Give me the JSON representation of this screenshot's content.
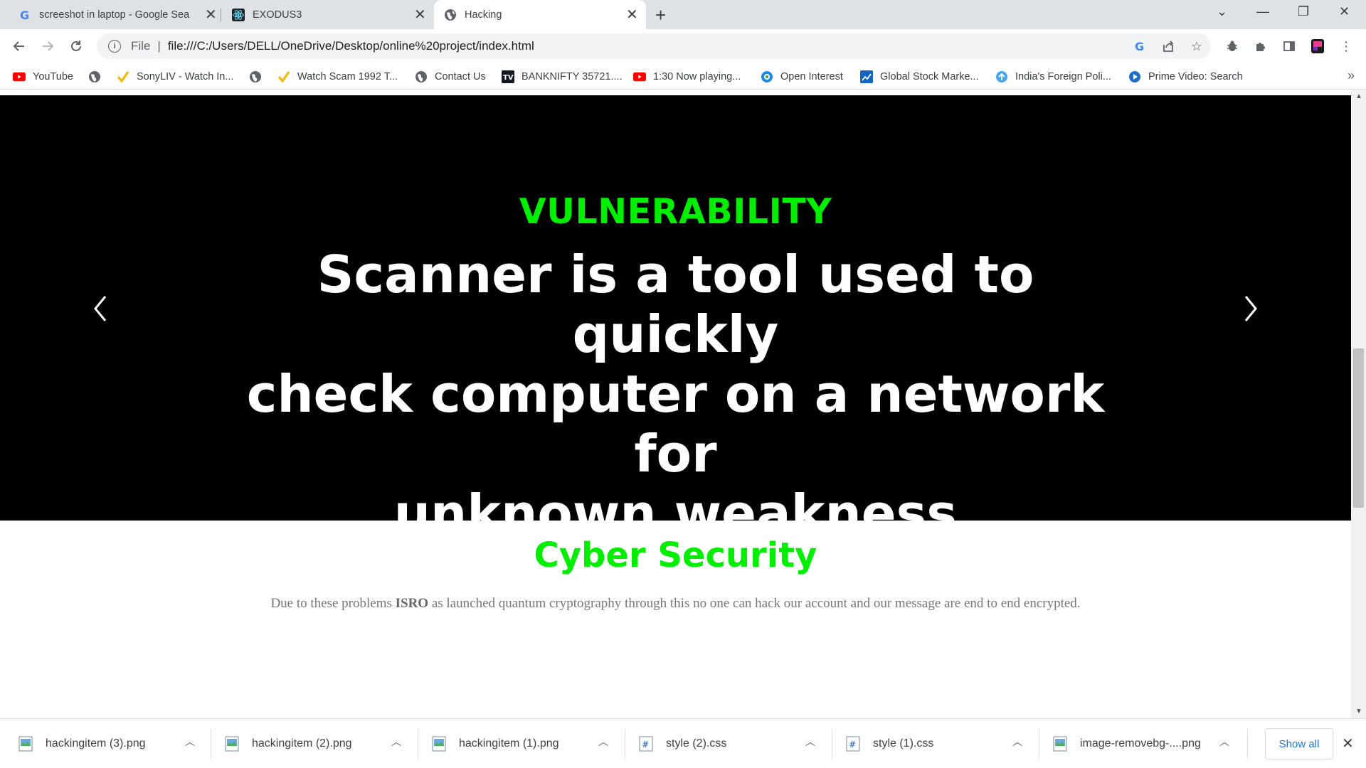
{
  "tabs": [
    {
      "title": "screeshot in laptop - Google Sea",
      "icon": "google-icon",
      "active": false
    },
    {
      "title": "EXODUS3",
      "icon": "react-atom-icon",
      "active": false
    },
    {
      "title": "Hacking",
      "icon": "globe-icon",
      "active": true
    }
  ],
  "toolbar": {
    "scheme": "File",
    "url": "file:///C:/Users/DELL/OneDrive/Desktop/online%20project/index.html"
  },
  "bookmarks": [
    {
      "label": "YouTube",
      "icon": "youtube-icon"
    },
    {
      "label": "",
      "icon": "globe-icon"
    },
    {
      "label": "SonyLIV - Watch In...",
      "icon": "sonyliv-check-icon"
    },
    {
      "label": "",
      "icon": "globe-icon"
    },
    {
      "label": "Watch Scam 1992 T...",
      "icon": "sonyliv-check-icon"
    },
    {
      "label": "Contact Us",
      "icon": "globe-icon"
    },
    {
      "label": "BANKNIFTY 35721....",
      "icon": "tradingview-icon"
    },
    {
      "label": "1:30 Now playing...",
      "icon": "youtube-icon"
    },
    {
      "label": "Open Interest",
      "icon": "oi-icon"
    },
    {
      "label": "Global Stock Marke...",
      "icon": "chart-icon"
    },
    {
      "label": "India's Foreign Poli...",
      "icon": "upload-icon"
    },
    {
      "label": "Prime Video: Search",
      "icon": "prime-video-icon"
    }
  ],
  "hero": {
    "kicker": "VULNERABILITY",
    "line1": "Scanner is a tool used to quickly",
    "line2": "check computer on a network for",
    "line3": "unknown weakness"
  },
  "section": {
    "title": "Cyber Security",
    "desc_before": "Due to these problems",
    "desc_bold": "ISRO",
    "desc_after": "as launched quantum cryptography through this no one can hack our account and our message are end to end encrypted."
  },
  "downloads": [
    {
      "name": "hackingitem (3).png",
      "icon": "image-file-icon"
    },
    {
      "name": "hackingitem (2).png",
      "icon": "image-file-icon"
    },
    {
      "name": "hackingitem (1).png",
      "icon": "image-file-icon"
    },
    {
      "name": "style (2).css",
      "icon": "css-file-icon"
    },
    {
      "name": "style (1).css",
      "icon": "css-file-icon"
    },
    {
      "name": "image-removebg-....png",
      "icon": "image-file-icon"
    }
  ],
  "show_all": "Show all",
  "colors": {
    "accent_green": "#00ee00",
    "hero_bg": "#000000",
    "link_blue": "#1a73e8"
  }
}
